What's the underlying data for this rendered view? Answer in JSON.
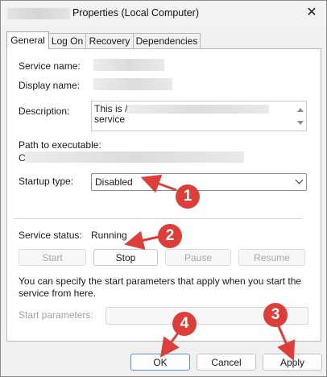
{
  "window": {
    "title": "Properties (Local Computer)",
    "close_icon": "close-icon"
  },
  "tabs": [
    {
      "label": "General",
      "active": true
    },
    {
      "label": "Log On",
      "active": false
    },
    {
      "label": "Recovery",
      "active": false
    },
    {
      "label": "Dependencies",
      "active": false
    }
  ],
  "general": {
    "service_name_label": "Service name:",
    "display_name_label": "Display name:",
    "description_label": "Description:",
    "description_text_start": "This is /",
    "description_text_line2": "service",
    "path_label": "Path to executable:",
    "path_value_start": "C",
    "startup_type_label": "Startup type:",
    "startup_type_value": "Disabled",
    "service_status_label": "Service status:",
    "service_status_value": "Running",
    "help_text": "You can specify the start parameters that apply when you start the service from here.",
    "start_params_label": "Start parameters:"
  },
  "service_buttons": {
    "start": "Start",
    "stop": "Stop",
    "pause": "Pause",
    "resume": "Resume"
  },
  "footer_buttons": {
    "ok": "OK",
    "cancel": "Cancel",
    "apply": "Apply"
  },
  "annotations": {
    "markers": [
      "1",
      "2",
      "3",
      "4"
    ],
    "color": "#dc3f3a"
  }
}
